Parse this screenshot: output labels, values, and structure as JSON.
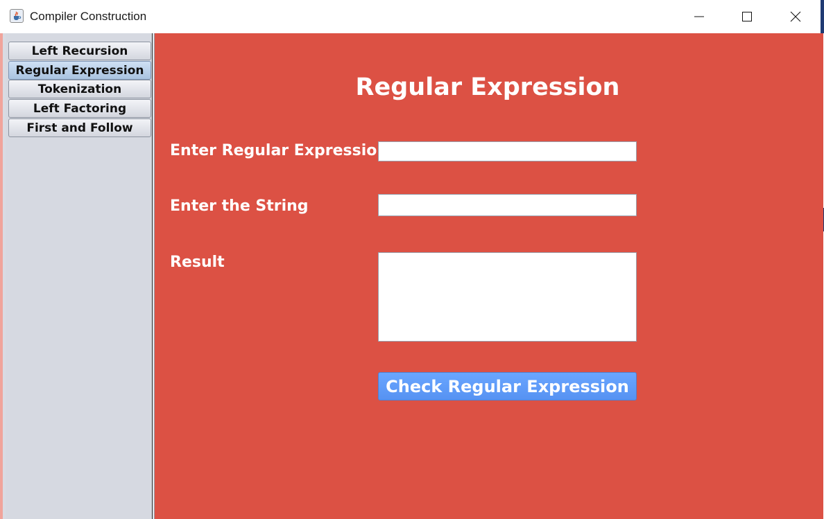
{
  "window": {
    "title": "Compiler Construction"
  },
  "sidebar": {
    "tabs": [
      {
        "label": "Left Recursion",
        "selected": false
      },
      {
        "label": "Regular Expression",
        "selected": true
      },
      {
        "label": "Tokenization",
        "selected": false
      },
      {
        "label": "Left Factoring",
        "selected": false
      },
      {
        "label": "First and Follow",
        "selected": false
      }
    ]
  },
  "main": {
    "heading": "Regular Expression",
    "regex_label": "Enter Regular Expression",
    "regex_value": "",
    "string_label": "Enter the String",
    "string_value": "",
    "result_label": "Result",
    "result_value": "",
    "check_button": "Check Regular Expression",
    "background_color": "#dc5144",
    "button_color": "#5b97f7"
  },
  "icons": {
    "app": "java-cup-icon",
    "minimize": "minimize-icon",
    "maximize": "maximize-icon",
    "close": "close-icon"
  }
}
